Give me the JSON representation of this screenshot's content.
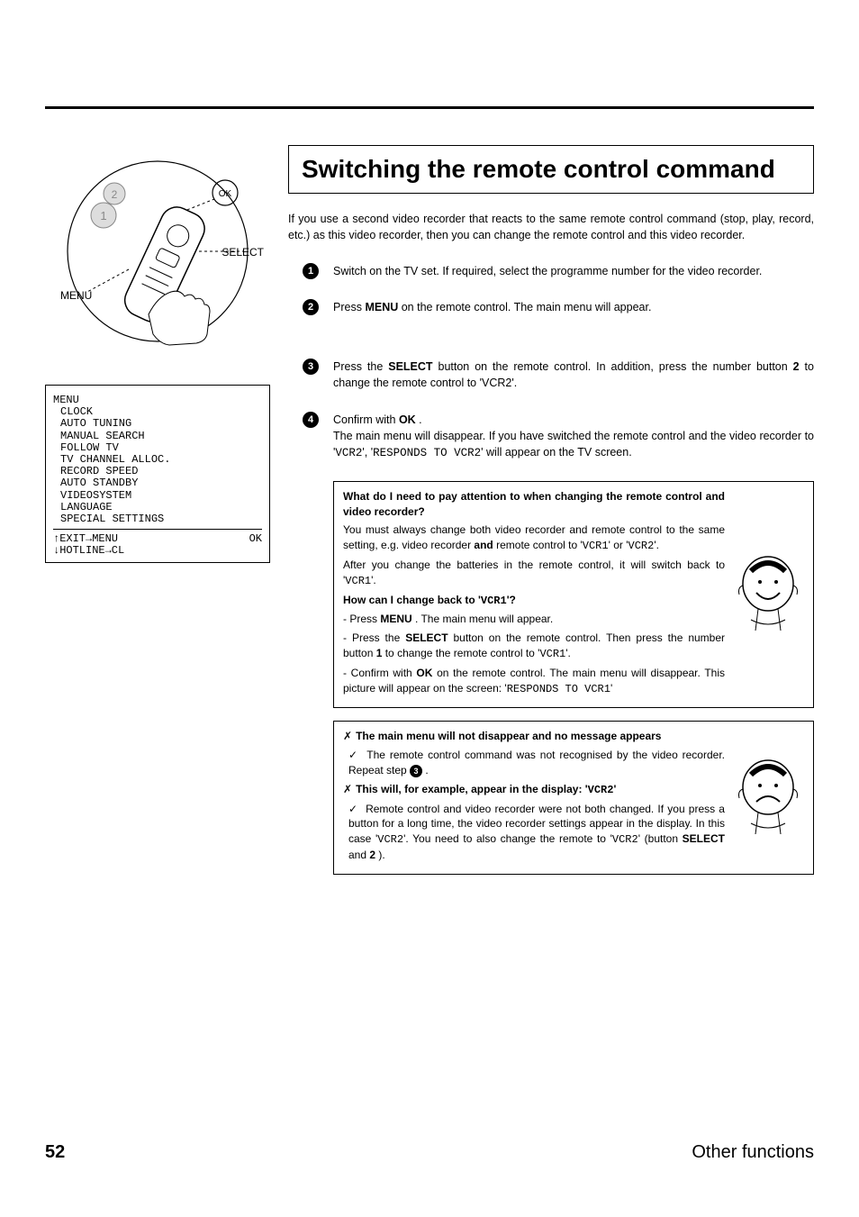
{
  "page": {
    "number": "52",
    "section": "Other functions"
  },
  "title": "Switching the remote control command",
  "intro": "If you use a second video recorder that reacts to the same remote control command (stop, play, record, etc.) as this video recorder, then you can change the remote control and this video recorder.",
  "remote_labels": {
    "ok": "OK",
    "select": "SELECT",
    "menu": "MENU"
  },
  "osd": {
    "title": "MENU",
    "items": [
      "CLOCK",
      "AUTO TUNING",
      "MANUAL SEARCH",
      "FOLLOW TV",
      "TV CHANNEL ALLOC.",
      "RECORD SPEED",
      "AUTO STANDBY",
      "VIDEOSYSTEM",
      "LANGUAGE",
      "SPECIAL SETTINGS"
    ],
    "footer_left_top": "↑EXIT→MENU",
    "footer_left_bot": "↓HOTLINE→CL",
    "footer_right": "OK"
  },
  "steps": {
    "s1": {
      "pre": "Switch on the TV set. If required, select the programme number for the video recorder."
    },
    "s2": {
      "pre": "Press ",
      "menu": "MENU",
      "post": " on the remote control. The main menu will appear."
    },
    "s3": {
      "pre": "Press the ",
      "select": "SELECT",
      "mid": " button on the remote control. In addition, press the number button ",
      "two": "2",
      "post": " to change the remote control to 'VCR2'."
    },
    "s4": {
      "pre": "Confirm with ",
      "ok": "OK",
      "dot": " .",
      "body_a": "The main menu will disappear. If you have switched the remote control and the video recorder to '",
      "vcr2": "VCR2",
      "body_b": "', '",
      "responds": "RESPONDS TO VCR2",
      "body_c": "' will appear on the TV screen."
    }
  },
  "box1": {
    "q1": "What do I need to pay attention to when changing the remote control and video recorder?",
    "a1_pre": "You must always change both video recorder and remote control to the same setting, e.g. video recorder ",
    "and": "and",
    "a1_mid": " remote control to '",
    "v1": "VCR1",
    "a1_or": "' or '",
    "v2": "VCR2",
    "a1_post": "'.",
    "a2_pre": "After you change the batteries in the remote control, it will switch back to '",
    "a2_v": "VCR1",
    "a2_post": "'.",
    "q2_pre": "How can I change back to '",
    "q2_v": "VCR1",
    "q2_post": "'?",
    "l1_pre": "- Press ",
    "l1_menu": "MENU",
    "l1_post": " . The main menu will appear.",
    "l2_pre": "- Press the ",
    "l2_select": "SELECT",
    "l2_mid": " button on the remote control. Then press the number button ",
    "l2_one": "1",
    "l2_mid2": " to change the remote control to '",
    "l2_v": "VCR1",
    "l2_post": "'.",
    "l3_pre": "- Confirm with ",
    "l3_ok": "OK",
    "l3_mid": " on the remote control. The main menu will disappear. This picture will appear on the screen: '",
    "l3_resp": "RESPONDS TO VCR1",
    "l3_post": "'"
  },
  "box2": {
    "h1": "The main menu will not disappear and no message appears",
    "p1_pre": "The remote control command was not recognised by the video recorder. Repeat step ",
    "p1_num": "3",
    "p1_post": " .",
    "h2_pre": "This will, for example, appear in the display: '",
    "h2_v": "VCR2",
    "h2_post": "'",
    "p2_pre": "Remote control and video recorder were not both changed. If you press a button for a long time, the video recorder settings appear in the display. In this case '",
    "p2_v": "VCR2",
    "p2_mid": "'. You need to also change the remote to '",
    "p2_v2": "VCR2",
    "p2_mid2": "' (button ",
    "p2_select": "SELECT",
    "p2_and": " and ",
    "p2_two": "2",
    "p2_post": " )."
  }
}
